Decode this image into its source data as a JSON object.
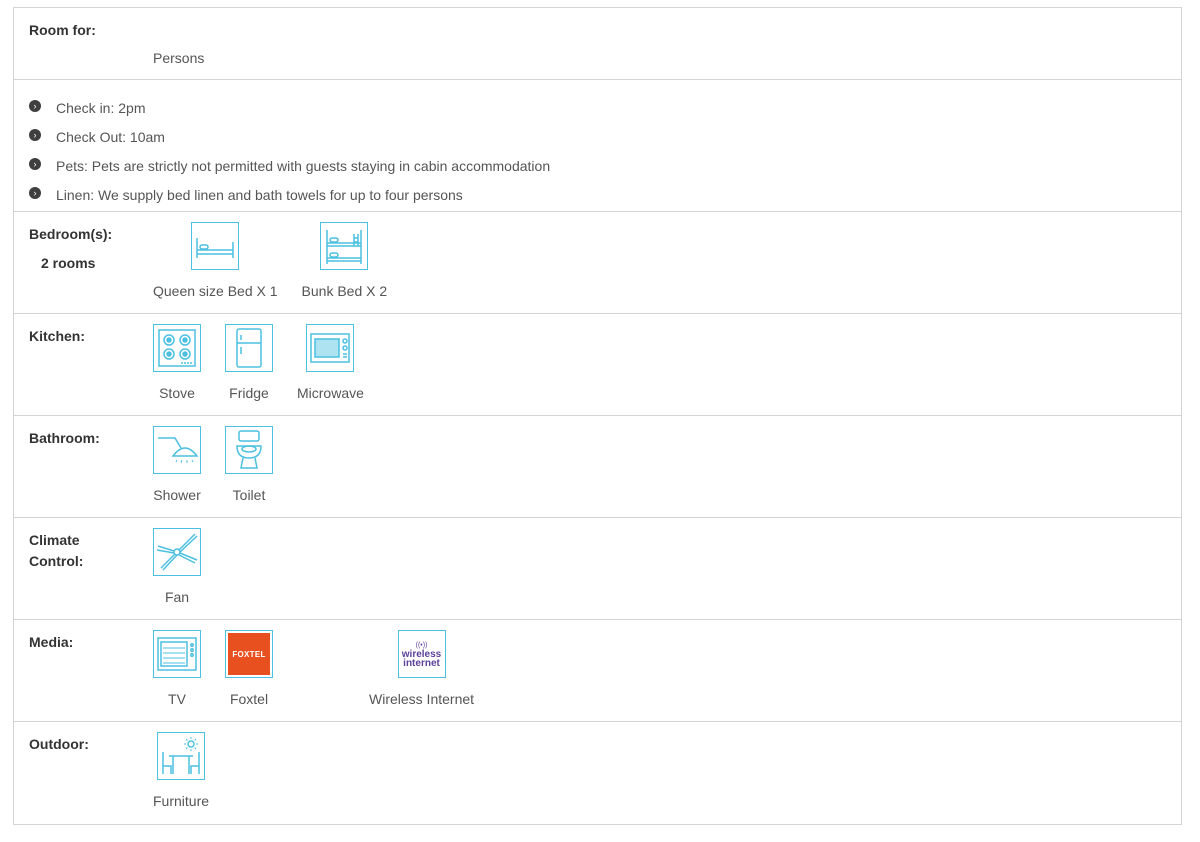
{
  "room_for": {
    "label": "Room for:",
    "value": "Persons"
  },
  "rules": [
    "Check in: 2pm",
    "Check Out: 10am",
    "Pets: Pets are strictly not permitted with guests staying in cabin accommodation",
    "Linen: We supply bed linen and bath towels for up to four persons"
  ],
  "bedrooms": {
    "label": "Bedroom(s):",
    "count": "2 rooms",
    "items": [
      {
        "icon": "bed-icon",
        "label": "Queen size Bed X 1"
      },
      {
        "icon": "bunk-bed-icon",
        "label": "Bunk Bed X 2"
      }
    ]
  },
  "kitchen": {
    "label": "Kitchen:",
    "items": [
      {
        "icon": "stove-icon",
        "label": "Stove"
      },
      {
        "icon": "fridge-icon",
        "label": "Fridge"
      },
      {
        "icon": "microwave-icon",
        "label": "Microwave"
      }
    ]
  },
  "bathroom": {
    "label": "Bathroom:",
    "items": [
      {
        "icon": "shower-icon",
        "label": "Shower"
      },
      {
        "icon": "toilet-icon",
        "label": "Toilet"
      }
    ]
  },
  "climate": {
    "label_line1": "Climate",
    "label_line2": "Control:",
    "items": [
      {
        "icon": "fan-icon",
        "label": "Fan"
      }
    ]
  },
  "media": {
    "label": "Media:",
    "items": [
      {
        "icon": "tv-icon",
        "label": "TV"
      },
      {
        "icon": "foxtel-logo",
        "label": "Foxtel",
        "logo_text": "FOXTEL"
      },
      {
        "icon": "wireless-internet-logo",
        "label": "Wireless Internet",
        "logo_line1": "wireless",
        "logo_line2": "internet"
      }
    ]
  },
  "outdoor": {
    "label": "Outdoor:",
    "items": [
      {
        "icon": "outdoor-furniture-icon",
        "label": "Furniture"
      }
    ]
  },
  "colors": {
    "icon_stroke": "#4cc0e0",
    "border": "#d4d4d4",
    "foxtel_orange": "#e8501f",
    "wifi_purple": "#5b3f99"
  }
}
